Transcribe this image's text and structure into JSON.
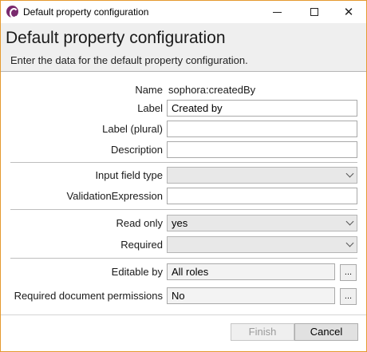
{
  "window": {
    "title": "Default property configuration",
    "icon": "app-logo-icon",
    "controls": {
      "minimize": "minimize-icon",
      "maximize": "maximize-icon",
      "close": "✕"
    }
  },
  "header": {
    "title": "Default property configuration",
    "subtitle": "Enter the data for the default property configuration."
  },
  "form": {
    "name": {
      "label": "Name",
      "value": "sophora:createdBy"
    },
    "label": {
      "label": "Label",
      "value": "Created by"
    },
    "label_plural": {
      "label": "Label (plural)",
      "value": ""
    },
    "description": {
      "label": "Description",
      "value": ""
    },
    "input_field_type": {
      "label": "Input field type",
      "value": ""
    },
    "validation_expression": {
      "label": "ValidationExpression",
      "value": ""
    },
    "read_only": {
      "label": "Read only",
      "value": "yes"
    },
    "required": {
      "label": "Required",
      "value": ""
    },
    "editable_by": {
      "label": "Editable by",
      "value": "All roles",
      "button": "..."
    },
    "required_doc_permissions": {
      "label": "Required document permissions",
      "value": "No",
      "button": "..."
    }
  },
  "footer": {
    "finish_label": "Finish",
    "cancel_label": "Cancel"
  },
  "colors": {
    "window_border": "#e59a2f",
    "header_bg": "#efefef",
    "app_icon": "#7a2a6e"
  }
}
